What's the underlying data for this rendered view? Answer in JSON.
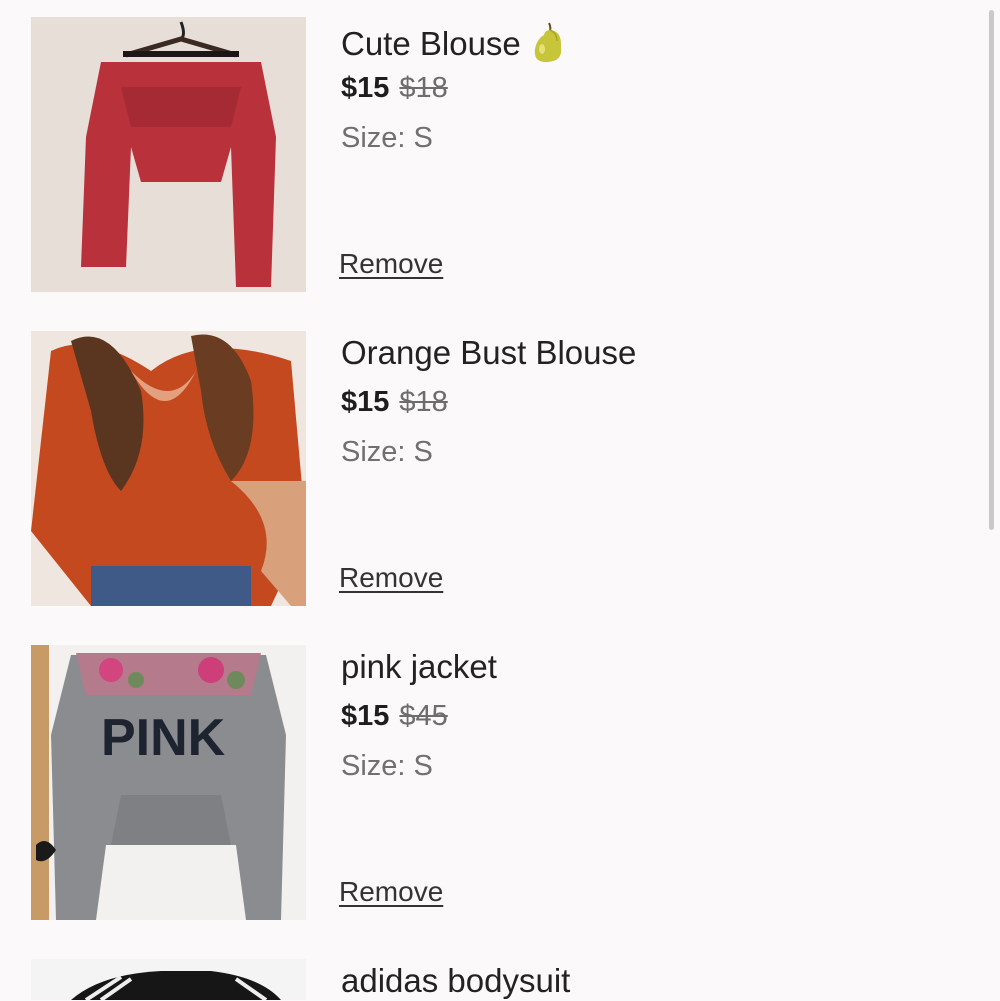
{
  "cart": {
    "remove_label": "Remove",
    "items": [
      {
        "title": "Cute Blouse",
        "price": "$15",
        "original_price": "$18",
        "size": "Size: S",
        "emoji": "pear-emoji",
        "image": "red long-sleeve crop blouse on hanger"
      },
      {
        "title": "Orange Bust Blouse",
        "price": "$15",
        "original_price": "$18",
        "size": "Size: S",
        "image": "orange bust crop blouse worn"
      },
      {
        "title": "pink jacket",
        "price": "$15",
        "original_price": "$45",
        "size": "Size: S",
        "image": "grey PINK hoodie with floral yoke",
        "image_text": "PINK"
      },
      {
        "title": "adidas bodysuit",
        "image": "black adidas top with white stripes"
      }
    ]
  },
  "colors": {
    "background": "#fbf9fa",
    "price": "#1e1e1e",
    "muted": "#707070"
  }
}
